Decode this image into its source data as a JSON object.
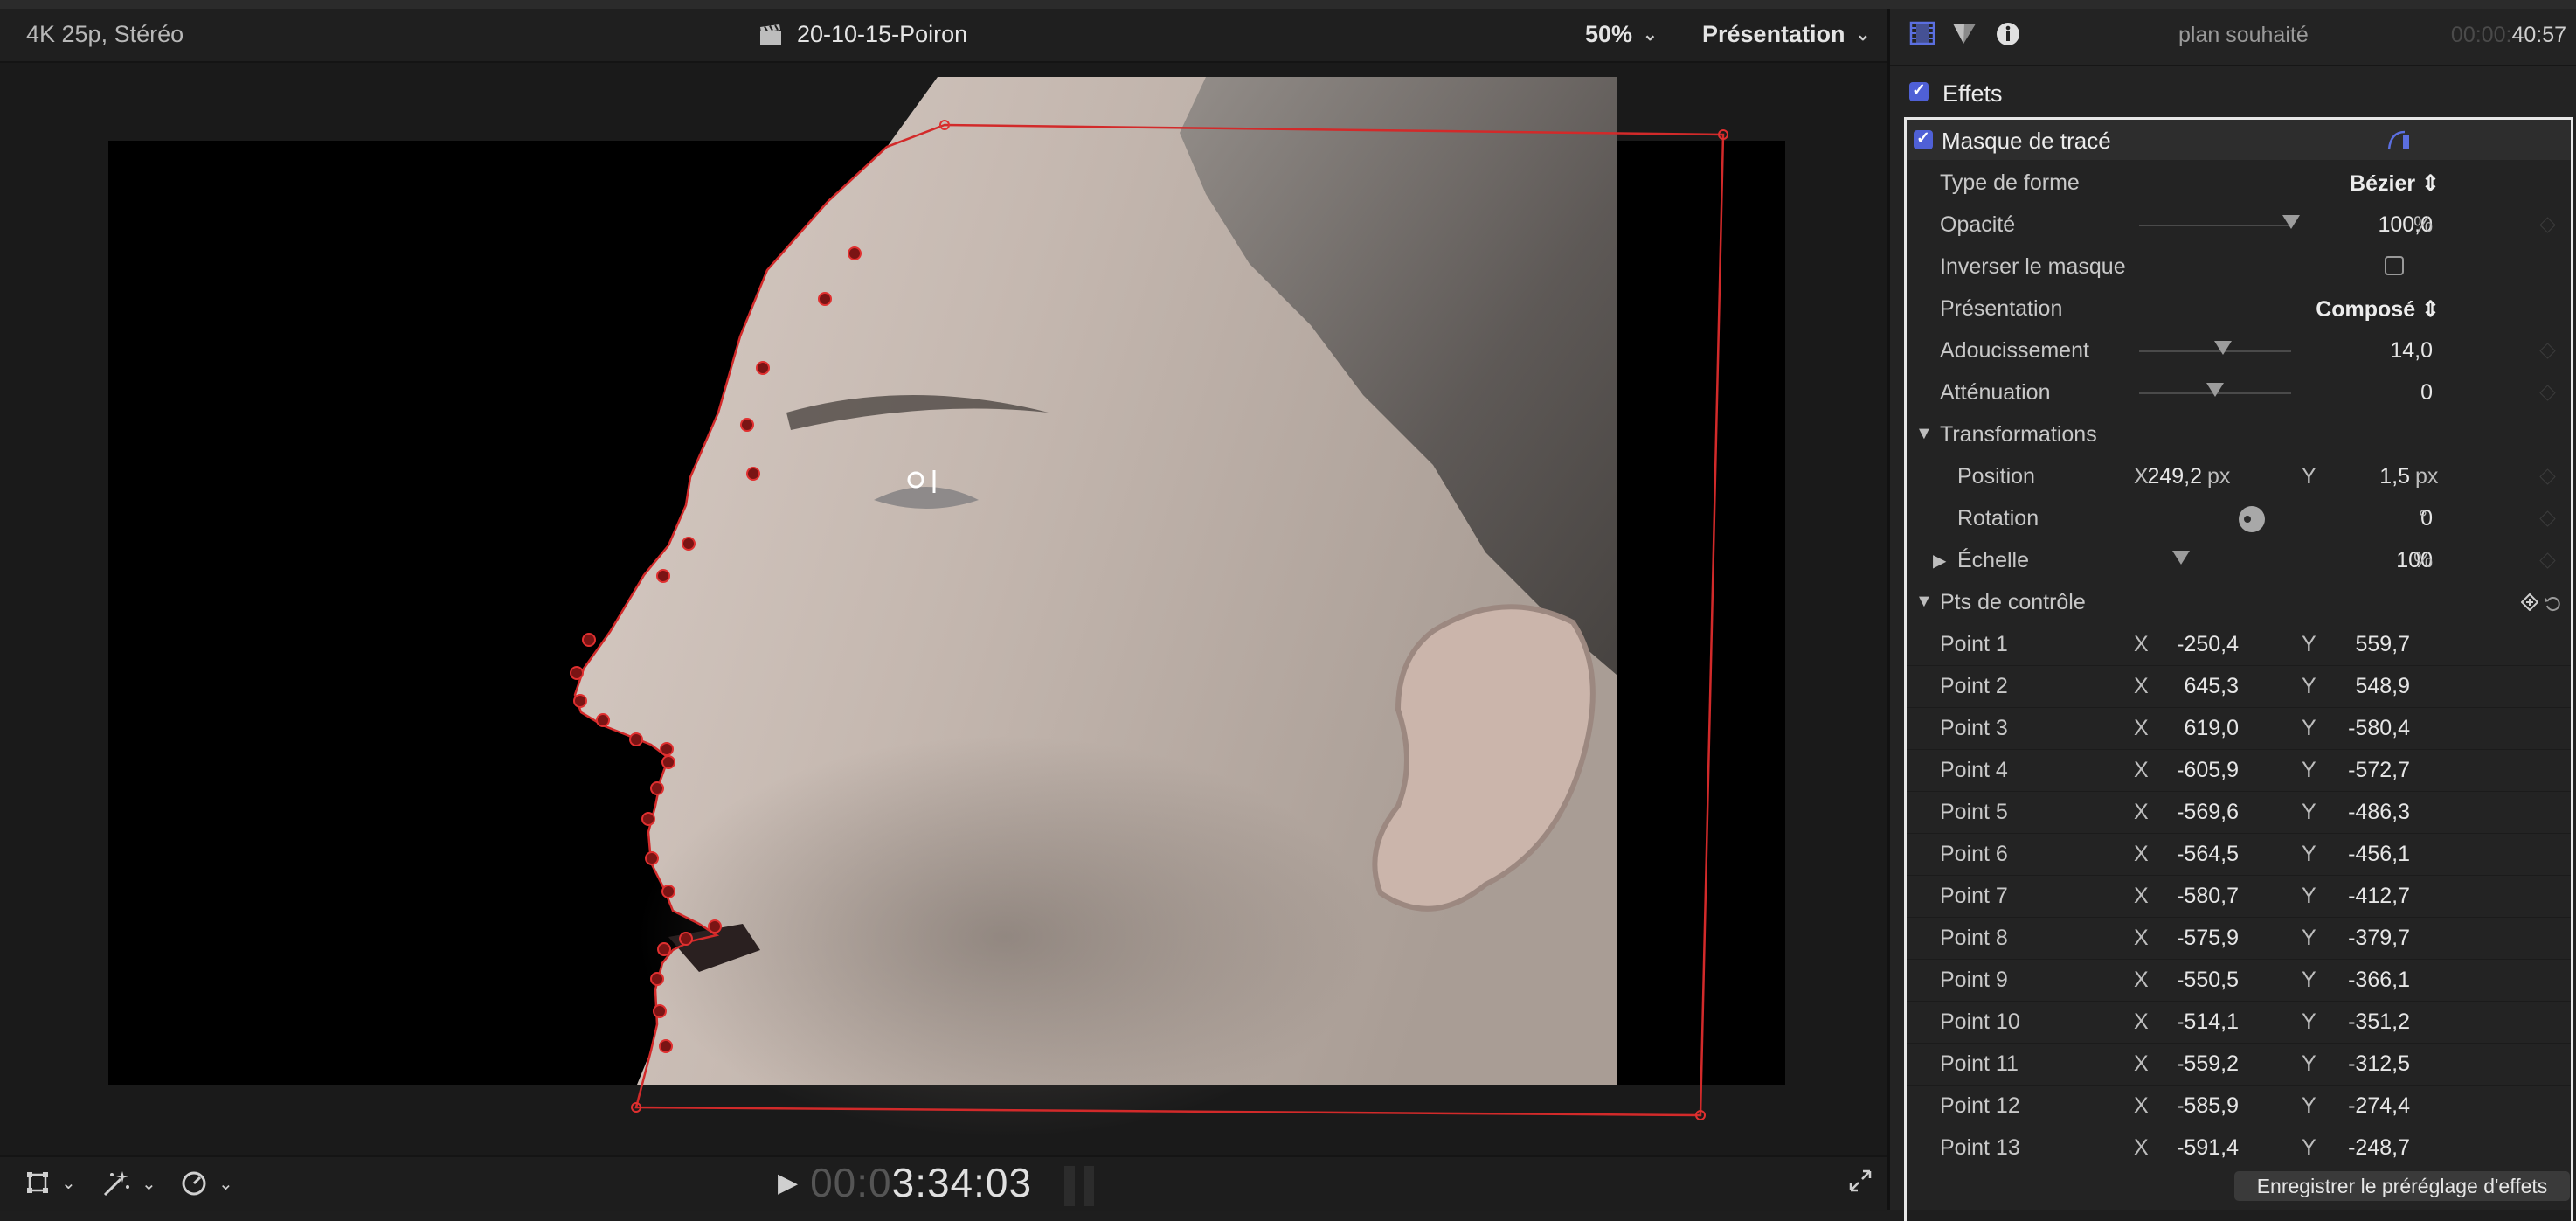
{
  "viewer": {
    "format": "4K 25p, Stéréo",
    "clip_title": "20-10-15-Poiron",
    "zoom": "50%",
    "view_menu": "Présentation",
    "timecode_dim": "00:0",
    "timecode_main": "3:34:03"
  },
  "inspector": {
    "title": "plan souhaité",
    "timecode_dim": "00:00:",
    "timecode_main": "40:57",
    "effects_label": "Effets",
    "mask": {
      "title": "Masque de tracé",
      "shape_type_label": "Type de forme",
      "shape_type_value": "Bézier",
      "opacity_label": "Opacité",
      "opacity_value": "100,0",
      "opacity_unit": "%",
      "opacity_level": 1.0,
      "invert_label": "Inverser le masque",
      "presentation_label": "Présentation",
      "presentation_value": "Composé",
      "feather_label": "Adoucissement",
      "feather_value": "14,0",
      "feather_level": 0.55,
      "falloff_label": "Atténuation",
      "falloff_value": "0",
      "falloff_level": 0.5,
      "transforms_label": "Transformations",
      "position_label": "Position",
      "position_x": "249,2",
      "position_y": "1,5",
      "position_unit": "px",
      "rotation_label": "Rotation",
      "rotation_value": "0",
      "rotation_unit": "°",
      "scale_label": "Échelle",
      "scale_value": "100",
      "scale_unit": "%",
      "control_points_label": "Pts de contrôle",
      "axis_x": "X",
      "axis_y": "Y",
      "points": [
        {
          "label": "Point 1",
          "x": "-250,4",
          "y": "559,7"
        },
        {
          "label": "Point 2",
          "x": "645,3",
          "y": "548,9"
        },
        {
          "label": "Point 3",
          "x": "619,0",
          "y": "-580,4"
        },
        {
          "label": "Point 4",
          "x": "-605,9",
          "y": "-572,7"
        },
        {
          "label": "Point 5",
          "x": "-569,6",
          "y": "-486,3"
        },
        {
          "label": "Point 6",
          "x": "-564,5",
          "y": "-456,1"
        },
        {
          "label": "Point 7",
          "x": "-580,7",
          "y": "-412,7"
        },
        {
          "label": "Point 8",
          "x": "-575,9",
          "y": "-379,7"
        },
        {
          "label": "Point 9",
          "x": "-550,5",
          "y": "-366,1"
        },
        {
          "label": "Point 10",
          "x": "-514,1",
          "y": "-351,2"
        },
        {
          "label": "Point 11",
          "x": "-559,2",
          "y": "-312,5"
        },
        {
          "label": "Point 12",
          "x": "-585,9",
          "y": "-274,4"
        },
        {
          "label": "Point 13",
          "x": "-591,4",
          "y": "-248,7"
        }
      ]
    },
    "save_preset": "Enregistrer le préréglage d'effets"
  },
  "colors": {
    "mask_path": "#d22a2a",
    "accent": "#4f60d6"
  }
}
